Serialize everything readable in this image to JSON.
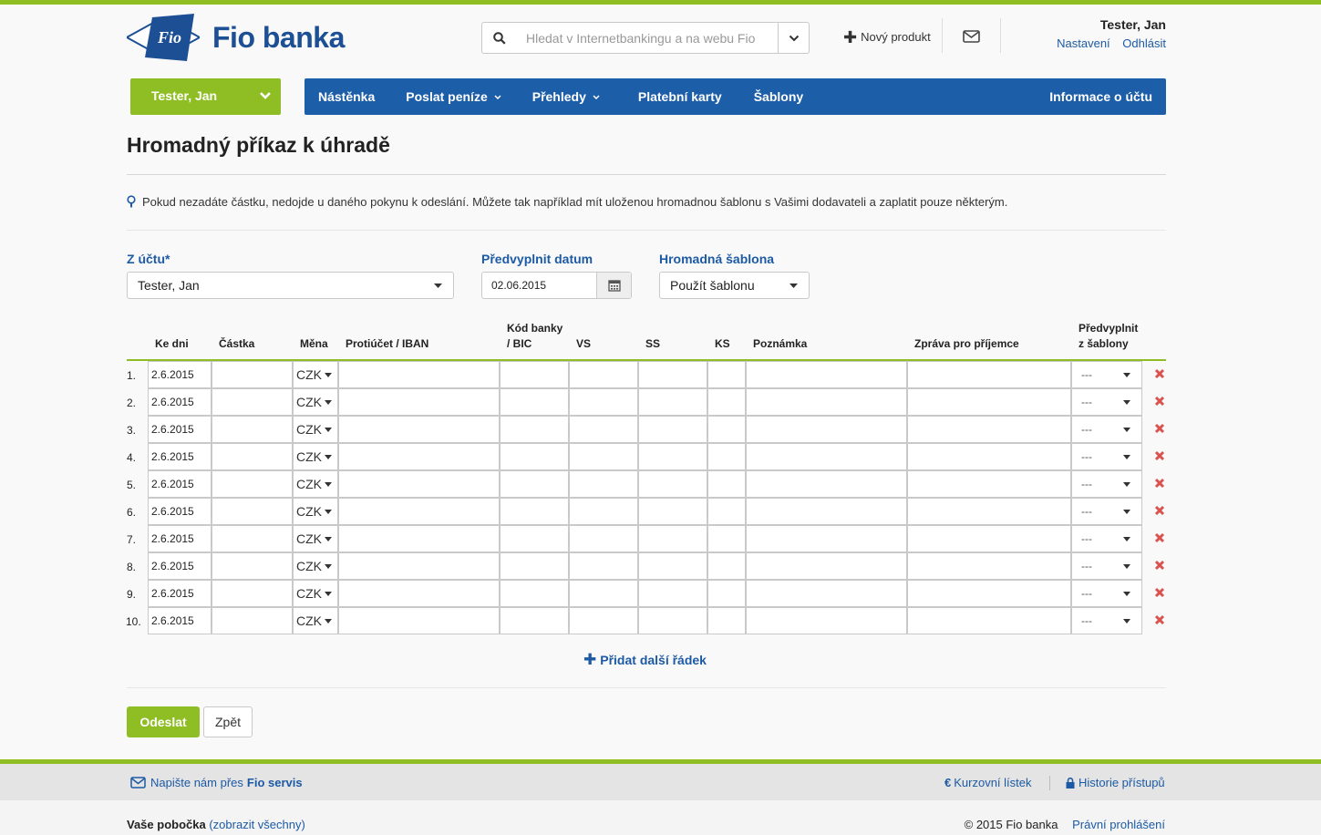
{
  "header": {
    "brand": "Fio banka",
    "logo_mark": "Fio",
    "search_placeholder": "Hledat v Internetbankingu a na webu Fio",
    "new_product": "Nový produkt",
    "user_name": "Tester, Jan",
    "settings_link": "Nastavení",
    "logout_link": "Odhlásit"
  },
  "account_selector": {
    "label": "Tester, Jan"
  },
  "nav": {
    "items": [
      {
        "label": "Nástěnka"
      },
      {
        "label": "Poslat peníze"
      },
      {
        "label": "Přehledy"
      },
      {
        "label": "Platební karty"
      },
      {
        "label": "Šablony"
      }
    ],
    "account_info": "Informace o účtu"
  },
  "page": {
    "title": "Hromadný příkaz k úhradě",
    "info_text": "Pokud nezadáte částku, nedojde u daného pokynu k odeslání. Můžete tak například mít uloženou hromadnou šablonu s Vašimi dodavateli a zaplatit pouze některým."
  },
  "form": {
    "from_account_label": "Z účtu*",
    "from_account_value": "Tester, Jan",
    "prefill_date_label": "Předvyplnit datum",
    "prefill_date_value": "02.06.2015",
    "template_label": "Hromadná šablona",
    "template_value": "Použít šablonu"
  },
  "table": {
    "headers": {
      "date": "Ke dni",
      "amount": "Částka",
      "currency": "Měna",
      "counter_account": "Protiúčet / IBAN",
      "bank_code_1": "Kód banky",
      "bank_code_2": "/ BIC",
      "vs": "VS",
      "ss": "SS",
      "ks": "KS",
      "note": "Poznámka",
      "message": "Zpráva pro příjemce",
      "prefill_1": "Předvyplnit",
      "prefill_2": "z šablony"
    },
    "rows": [
      {
        "num": "1.",
        "date": "2.6.2015",
        "currency": "CZK",
        "template": "---"
      },
      {
        "num": "2.",
        "date": "2.6.2015",
        "currency": "CZK",
        "template": "---"
      },
      {
        "num": "3.",
        "date": "2.6.2015",
        "currency": "CZK",
        "template": "---"
      },
      {
        "num": "4.",
        "date": "2.6.2015",
        "currency": "CZK",
        "template": "---"
      },
      {
        "num": "5.",
        "date": "2.6.2015",
        "currency": "CZK",
        "template": "---"
      },
      {
        "num": "6.",
        "date": "2.6.2015",
        "currency": "CZK",
        "template": "---"
      },
      {
        "num": "7.",
        "date": "2.6.2015",
        "currency": "CZK",
        "template": "---"
      },
      {
        "num": "8.",
        "date": "2.6.2015",
        "currency": "CZK",
        "template": "---"
      },
      {
        "num": "9.",
        "date": "2.6.2015",
        "currency": "CZK",
        "template": "---"
      },
      {
        "num": "10.",
        "date": "2.6.2015",
        "currency": "CZK",
        "template": "---"
      }
    ],
    "add_row": "Přidat další řádek"
  },
  "actions": {
    "send": "Odeslat",
    "back": "Zpět"
  },
  "footer": {
    "write_us": "Napište nám přes",
    "fio_servis": "Fio servis",
    "rates": "Kurzovní lístek",
    "access_history": "Historie přístupů",
    "branch_label": "Vaše pobočka",
    "branch_link": "(zobrazit všechny)",
    "copyright": "© 2015 Fio banka",
    "legal": "Právní prohlášení"
  },
  "colors": {
    "brand_green": "#8fbe24",
    "brand_blue": "#1d5ea8",
    "link_blue": "#1c5aa5",
    "delete_red": "#d9534f"
  }
}
